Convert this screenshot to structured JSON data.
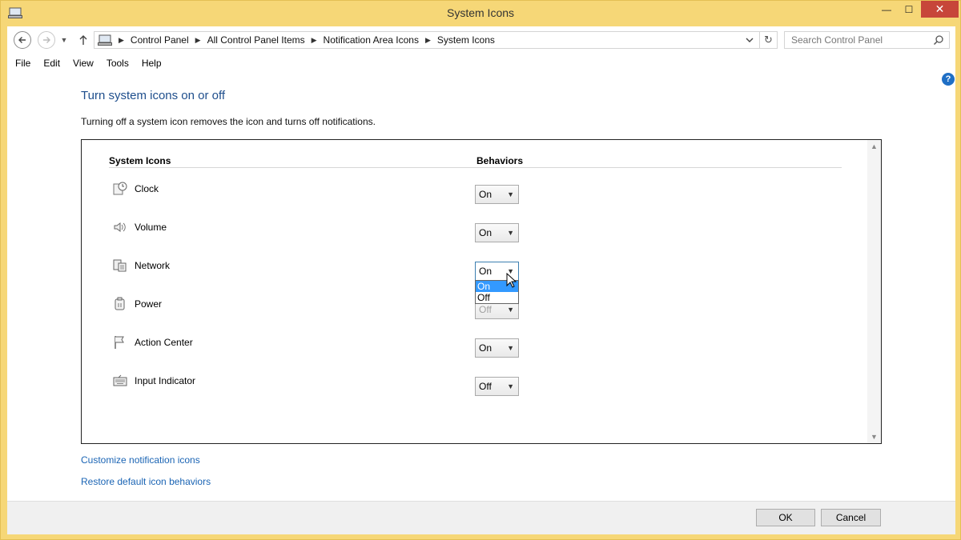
{
  "window": {
    "title": "System Icons",
    "controls": {
      "minimize": "—",
      "maximize": "☐",
      "close": "✕"
    }
  },
  "navigation": {
    "back_icon": "back-arrow-icon",
    "forward_icon": "forward-arrow-icon",
    "up_icon": "up-arrow-icon"
  },
  "address": {
    "breadcrumbs": [
      "Control Panel",
      "All Control Panel Items",
      "Notification Area Icons",
      "System Icons"
    ]
  },
  "search": {
    "placeholder": "Search Control Panel"
  },
  "menu": {
    "items": [
      "File",
      "Edit",
      "View",
      "Tools",
      "Help"
    ]
  },
  "content": {
    "help_label": "?",
    "title": "Turn system icons on or off",
    "description": "Turning off a system icon removes the icon and turns off notifications.",
    "table": {
      "col_icons": "System Icons",
      "col_behaviors": "Behaviors",
      "rows": [
        {
          "label": "Clock",
          "value": "On",
          "icon": "clock-icon"
        },
        {
          "label": "Volume",
          "value": "On",
          "icon": "volume-icon"
        },
        {
          "label": "Network",
          "value": "On",
          "icon": "network-icon"
        },
        {
          "label": "Power",
          "value": "Off",
          "icon": "power-icon"
        },
        {
          "label": "Action Center",
          "value": "On",
          "icon": "flag-icon"
        },
        {
          "label": "Input Indicator",
          "value": "Off",
          "icon": "keyboard-icon"
        }
      ],
      "open_dropdown": {
        "options": [
          "On",
          "Off"
        ],
        "highlighted": "On"
      }
    },
    "links": {
      "customize": "Customize notification icons",
      "restore": "Restore default icon behaviors"
    }
  },
  "footer": {
    "ok": "OK",
    "cancel": "Cancel"
  }
}
